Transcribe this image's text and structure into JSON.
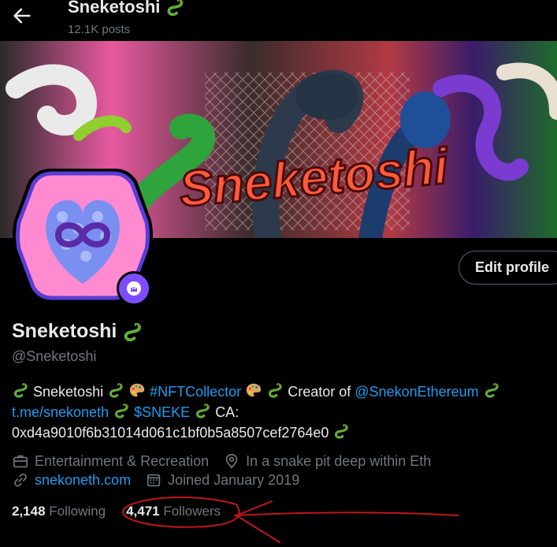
{
  "header": {
    "back_icon": "arrow-left-icon",
    "title": "Sneketoshi",
    "posts_count": "12.1K posts"
  },
  "banner": {
    "text": "Sneketoshi"
  },
  "profile": {
    "edit_button": "Edit profile",
    "name": "Sneketoshi",
    "handle": "@Sneketoshi",
    "bio": {
      "line1_a": "Sneketoshi",
      "line1_hashtag": "#NFTCollector",
      "line1_b": "Creator of",
      "line1_mention": "@SnekonEthereum",
      "line2_link": "t.me/snekoneth",
      "line2_cashtag": "$SNEKE",
      "line2_ca": "CA:",
      "line3_address": "0xd4a9010f6b31014d061c1bf0b5a8507cef2764e0"
    },
    "category": "Entertainment & Recreation",
    "location": "In a snake pit deep within Eth",
    "website": "snekoneth.com",
    "joined": "Joined January 2019",
    "following_count": "2,148",
    "following_label": "Following",
    "followers_count": "4,471",
    "followers_label": "Followers"
  },
  "colors": {
    "background": "#000000",
    "link": "#1d9bf0",
    "secondary_text": "#71767b",
    "badge": "#7d4cff",
    "annotation": "#c0161c"
  }
}
